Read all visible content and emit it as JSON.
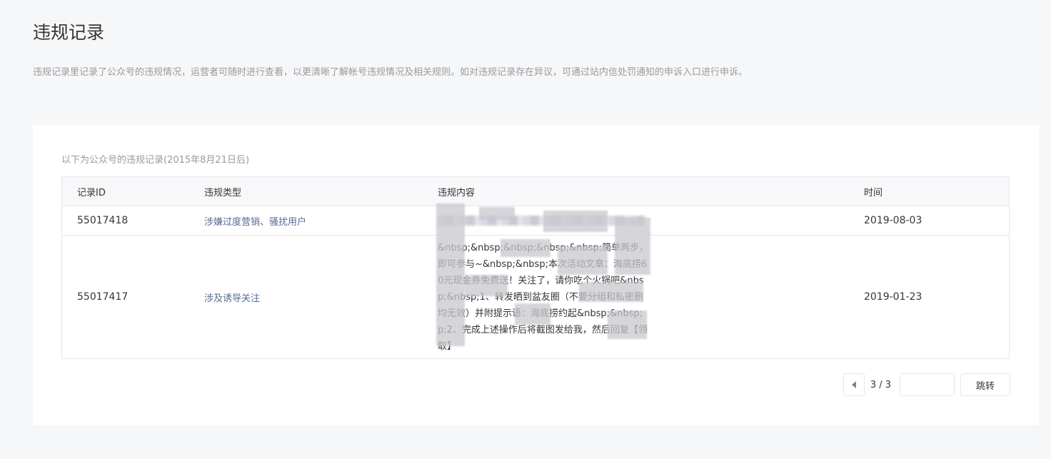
{
  "page": {
    "title": "违规记录",
    "description": "违规记录里记录了公众号的违规情况，运营者可随时进行查看，以更清晰了解帐号违规情况及相关规则。如对违规记录存在异议，可通过站内信处罚通知的申诉入口进行申诉。"
  },
  "table": {
    "caption": "以下为公众号的违规记录(2015年8月21日后)",
    "headers": [
      "记录ID",
      "违规类型",
      "违规内容",
      "时间"
    ],
    "rows": [
      {
        "id": "55017418",
        "type": "涉嫌过度营销、骚扰用户",
        "content": "",
        "time": "2019-08-03"
      },
      {
        "id": "55017417",
        "type": "涉及诱导关注",
        "content": "&nbsp;&nbsp;&nbsp;&nbsp;&nbsp;简单两步，即可参与~&nbsp;&nbsp;本次活动文章：海底捞60元现金券免费送！关注了，请你吃个火锅吧&nbsp;&nbsp;1、转发晒到盆友圈（不要分组和私密删均无效）并附提示语：海底捞约起&nbsp;&nbsp;p;2、完成上述操作后将截图发给我，然后回复【领取】",
        "time": "2019-01-23"
      }
    ]
  },
  "pager": {
    "page_text": "3 / 3",
    "input_value": "",
    "go_label": "跳转"
  },
  "colors": {
    "link": "#576b95",
    "background": "#f6f7f9",
    "border": "#e7e7eb"
  }
}
